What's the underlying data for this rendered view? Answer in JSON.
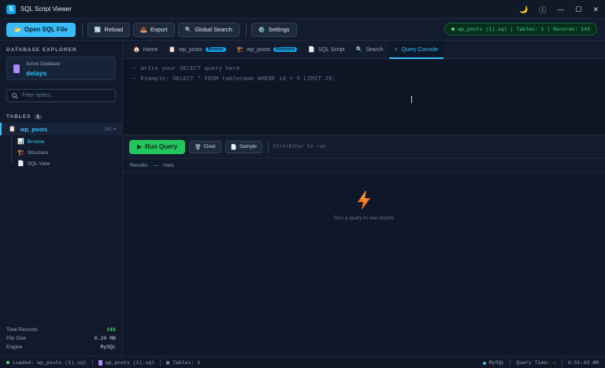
{
  "app": {
    "title": "SQL Script Viewer",
    "icon_letter": "S"
  },
  "window_controls": {
    "theme": "🌙",
    "info": "ⓘ",
    "minimize": "—",
    "maximize": "☐",
    "close": "✕"
  },
  "toolbar": {
    "open_label": "Open SQL File",
    "reload_label": "Reload",
    "export_label": "Export",
    "search_label": "Global Search",
    "settings_label": "Settings",
    "status": "wp_posts (1).sql | Tables: 1 | Records: 141"
  },
  "sidebar": {
    "heading": "DATABASE EXPLORER",
    "active_db_label": "Active Database",
    "active_db_name": "delays",
    "filter_placeholder": "Filter tables...",
    "tables_heading": "TABLES",
    "tables_count": "1",
    "table": {
      "name": "wp_posts",
      "count": "141",
      "caret": "▾"
    },
    "subitems": [
      "Browse",
      "Structure",
      "SQL View"
    ],
    "stats": [
      {
        "label": "Total Records",
        "value": "141"
      },
      {
        "label": "File Size",
        "value": "0.20 MB"
      },
      {
        "label": "Engine",
        "value": "MySQL"
      }
    ]
  },
  "tabs": [
    {
      "label": "Home"
    },
    {
      "label": "wp_posts",
      "tag": "Browse"
    },
    {
      "label": "wp_posts",
      "tag": "Structure"
    },
    {
      "label": "SQL Script"
    },
    {
      "label": "Search"
    },
    {
      "label": "Query Console"
    }
  ],
  "editor": {
    "line1": "-- Write your SELECT query here",
    "line2": "-- Example: SELECT * FROM tablename WHERE id > 5 LIMIT 20;"
  },
  "actions": {
    "run_label": "Run Query",
    "clear_label": "Clear",
    "sample_label": "Sample",
    "hint": "Ctrl+Enter to run"
  },
  "results": {
    "label": "Results:",
    "count": "—",
    "unit": "rows",
    "empty_text": "Run a query to see results"
  },
  "statusbar": {
    "loaded": "Loaded: wp_posts (1).sql",
    "file": "wp_posts (1).sql",
    "tables": "Tables: 1",
    "engine": "MySQL",
    "query_time": "Query Time: —",
    "clock": "6:51:43 AM"
  },
  "colors": {
    "accent": "#38bdf8",
    "success": "#22c55e",
    "background": "#0f172a"
  }
}
